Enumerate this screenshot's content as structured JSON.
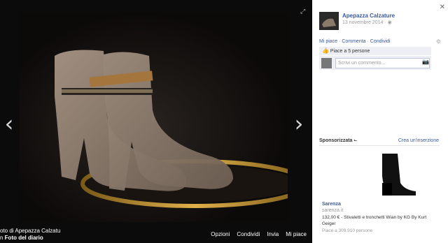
{
  "caption": {
    "line1": "oto di Apepazza Calzatu",
    "line2_prefix": "n ",
    "line2_album": "Foto del diario"
  },
  "actions": [
    "Opzioni",
    "Condividi",
    "Invia",
    "Mi piace"
  ],
  "sidebar": {
    "page_name": "Apepazza Calzature",
    "date": "13 novembre 2014 · ",
    "links": {
      "like": "Mi piace",
      "comment": "Commenta",
      "share": "Condividi"
    },
    "likes_text": "Piace a 5 persone",
    "comment_placeholder": "Scrivi un commento...",
    "sponsored_title": "Sponsorizzata",
    "create_ad": "Crea un'inserzione",
    "ad": {
      "brand": "Sarenza",
      "url": "sarenza.it",
      "description": "132,00 € - Stivaletti e tronchetti Wian by KG By Kurt Geiger",
      "likes": "Piace a 309.910 persone"
    }
  },
  "icons": {
    "close": "close-icon",
    "expand": "expand-icon",
    "gear": "gear-icon",
    "camera": "camera-icon",
    "prev": "chevron-left-icon",
    "next": "chevron-right-icon",
    "globe": "globe-icon"
  }
}
